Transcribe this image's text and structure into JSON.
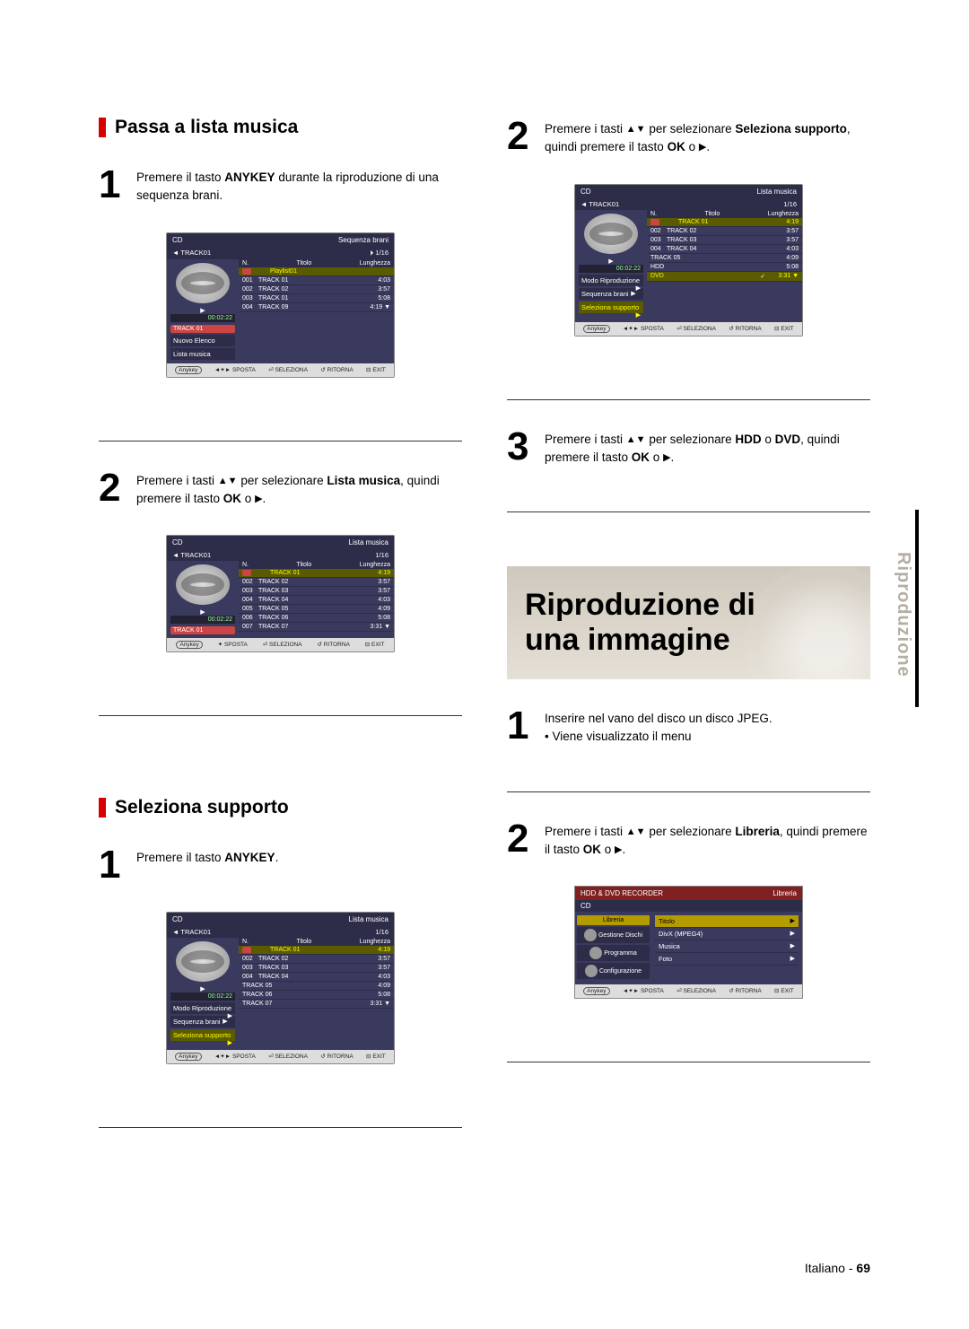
{
  "side_tab": "Riproduzione",
  "left": {
    "section1_title": "Passa a lista musica",
    "step1": {
      "num": "1",
      "text_a": "Premere il tasto ",
      "text_b": "ANYKEY",
      "text_c": " durante la riproduzione di una sequenza brani."
    },
    "step2": {
      "num": "2",
      "text_a": "Premere i tasti ",
      "arrows": "▲▼",
      "text_b": " per selezionare ",
      "text_c": "Lista musica",
      "text_d": ", quindi premere il tasto ",
      "text_e": "OK",
      "text_f": " o ",
      "arrow_r": "▶",
      "text_g": "."
    },
    "section2_title": "Seleziona supporto",
    "step2_1": {
      "num": "1",
      "text_a": "Premere il tasto ",
      "text_b": "ANYKEY",
      "text_c": "."
    },
    "shot1": {
      "top_left": "CD",
      "top_right": "Sequenza brani",
      "sub_left": "TRACK01",
      "sub_mid": "⏵",
      "sub_right": "1/16",
      "timer": "00:02:22",
      "left_tag": "TRACK 01",
      "head": {
        "n": "N.",
        "t": "Titolo",
        "l": "Lunghezza"
      },
      "rows": [
        {
          "sel": true,
          "no": "",
          "title": "Playlist01",
          "len": ""
        },
        {
          "no": "001",
          "title": "TRACK 01",
          "len": "4:03"
        },
        {
          "no": "002",
          "title": "TRACK 02",
          "len": "3:57"
        },
        {
          "no": "003",
          "title": "TRACK 01",
          "len": "5:08"
        },
        {
          "no": "004",
          "title": "TRACK 09",
          "len": "4:19"
        }
      ],
      "menu": [
        "Nuovo Elenco",
        "Lista musica"
      ],
      "footer": [
        "SPOSTA",
        "SELEZIONA",
        "RITORNA",
        "EXIT"
      ]
    },
    "shot2": {
      "top_left": "CD",
      "top_right": "Lista musica",
      "sub_left": "TRACK01",
      "sub_right": "1/16",
      "timer": "00:02:22",
      "left_tag": "TRACK 01",
      "head": {
        "n": "N.",
        "t": "Titolo",
        "l": "Lunghezza"
      },
      "rows": [
        {
          "sel": true,
          "no": "",
          "title": "TRACK 01",
          "len": "4:19"
        },
        {
          "no": "002",
          "title": "TRACK 02",
          "len": "3:57"
        },
        {
          "no": "003",
          "title": "TRACK 03",
          "len": "3:57"
        },
        {
          "no": "004",
          "title": "TRACK 04",
          "len": "4:03"
        },
        {
          "no": "005",
          "title": "TRACK 05",
          "len": "4:09"
        },
        {
          "no": "006",
          "title": "TRACK 06",
          "len": "5:08"
        },
        {
          "no": "007",
          "title": "TRACK 07",
          "len": "3:31"
        }
      ],
      "footer": [
        "SPOSTA",
        "SELEZIONA",
        "RITORNA",
        "EXIT"
      ]
    },
    "shot3": {
      "top_left": "CD",
      "top_right": "Lista musica",
      "sub_left": "TRACK01",
      "sub_right": "1/16",
      "timer": "00:02:22",
      "head": {
        "n": "N.",
        "t": "Titolo",
        "l": "Lunghezza"
      },
      "rows": [
        {
          "sel": true,
          "no": "",
          "title": "TRACK 01",
          "len": "4:19"
        },
        {
          "no": "002",
          "title": "TRACK 02",
          "len": "3:57"
        },
        {
          "no": "003",
          "title": "TRACK 03",
          "len": "3:57"
        },
        {
          "no": "004",
          "title": "TRACK 04",
          "len": "4:03"
        }
      ],
      "menu": [
        {
          "label": "Modo Riproduzione",
          "val": "TRACK 05",
          "len": "4:09"
        },
        {
          "label": "Sequenza brani",
          "val": "TRACK 06",
          "len": "5:08"
        },
        {
          "label": "Seleziona supporto",
          "hi": true,
          "val": "TRACK 07",
          "len": "3:31"
        }
      ],
      "footer": [
        "SPOSTA",
        "SELEZIONA",
        "RITORNA",
        "EXIT"
      ]
    }
  },
  "right": {
    "step2": {
      "num": "2",
      "text_a": "Premere i tasti ",
      "arrows": "▲▼",
      "text_b": " per selezionare ",
      "text_c": "Seleziona supporto",
      "text_d": ", quindi premere il tasto ",
      "text_e": "OK",
      "text_f": " o ",
      "arrow_r": "▶",
      "text_g": "."
    },
    "step3": {
      "num": "3",
      "text_a": "Premere i tasti ",
      "arrows": "▲▼",
      "text_b": " per selezionare ",
      "text_c": "HDD",
      "text_d": " o ",
      "text_e": "DVD",
      "text_f": ", quindi premere il tasto ",
      "text_g": "OK",
      "text_h": " o ",
      "arrow_r": "▶",
      "text_i": "."
    },
    "hero_title_1": "Riproduzione di",
    "hero_title_2": "una immagine",
    "img_step1": {
      "num": "1",
      "text_a": "Inserire nel vano del disco un disco JPEG.",
      "bullet": "• Viene visualizzato il menu"
    },
    "img_step2": {
      "num": "2",
      "text_a": "Premere i tasti ",
      "arrows": "▲▼",
      "text_b": " per selezionare ",
      "text_c": "Libreria",
      "text_d": ", quindi premere il tasto ",
      "text_e": "OK",
      "text_f": " o ",
      "arrow_r": "▶",
      "text_g": "."
    },
    "shot4": {
      "top_left": "CD",
      "top_right": "Lista musica",
      "sub_left": "TRACK01",
      "sub_right": "1/16",
      "timer": "00:02:22",
      "head": {
        "n": "N.",
        "t": "Titolo",
        "l": "Lunghezza"
      },
      "rows": [
        {
          "sel": true,
          "no": "",
          "title": "TRACK 01",
          "len": "4:19"
        },
        {
          "no": "002",
          "title": "TRACK 02",
          "len": "3:57"
        },
        {
          "no": "003",
          "title": "TRACK 03",
          "len": "3:57"
        },
        {
          "no": "004",
          "title": "TRACK 04",
          "len": "4:03"
        }
      ],
      "menu": [
        {
          "label": "Modo Riproduzione",
          "val": "TRACK 05",
          "len": "4:09"
        },
        {
          "label": "Sequenza brani",
          "val": "HDD",
          "len": "5:08"
        },
        {
          "label": "Seleziona supporto",
          "hi": true,
          "val": "DVD",
          "len": "3:31",
          "chk": "✓"
        }
      ],
      "footer": [
        "SPOSTA",
        "SELEZIONA",
        "RITORNA",
        "EXIT"
      ]
    },
    "shot5": {
      "top_left": "HDD & DVD RECORDER",
      "top_right": "Libreria",
      "header": "CD",
      "left_items": [
        {
          "label": "Libreria",
          "sel": true
        },
        {
          "label": "Gestione Dischi"
        },
        {
          "label": "Programma"
        },
        {
          "label": "Configurazione"
        }
      ],
      "right_items": [
        {
          "label": "Titolo",
          "sel": true
        },
        {
          "label": "DivX (MPEG4)"
        },
        {
          "label": "Musica"
        },
        {
          "label": "Foto"
        }
      ],
      "footer": [
        "SPOSTA",
        "SELEZIONA",
        "RITORNA",
        "EXIT"
      ]
    }
  },
  "footer": {
    "lang": "Italiano",
    "sep": " - ",
    "page": "69"
  }
}
